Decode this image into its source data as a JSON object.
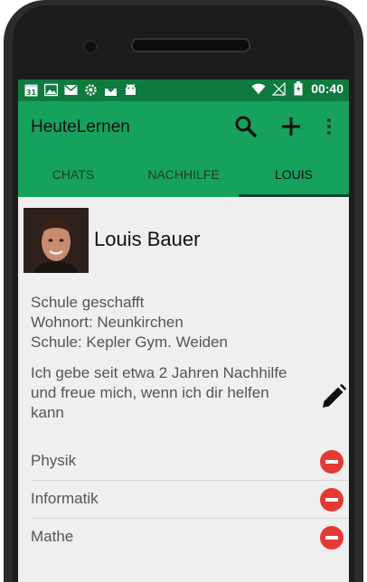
{
  "status_bar": {
    "time": "00:40",
    "calendar_day": "31"
  },
  "app_bar": {
    "title": "HeuteLernen"
  },
  "tabs": [
    {
      "label": "CHATS",
      "active": false
    },
    {
      "label": "NACHHILFE",
      "active": false
    },
    {
      "label": "LOUIS",
      "active": true
    }
  ],
  "profile": {
    "name": "Louis Bauer",
    "info_lines": [
      "Schule geschafft",
      "Wohnort: Neunkirchen",
      "Schule: Kepler Gym. Weiden"
    ],
    "bio_lines": [
      "Ich gebe seit etwa 2 Jahren Nachhilfe",
      "und freue mich, wenn ich dir helfen",
      "kann"
    ]
  },
  "subjects": [
    {
      "label": "Physik"
    },
    {
      "label": "Informatik"
    },
    {
      "label": "Mathe"
    }
  ],
  "colors": {
    "statusbar": "#0f7a3e",
    "appbar": "#16a15c",
    "remove": "#e53935"
  },
  "icons": {
    "search": "search-icon",
    "add": "plus-icon",
    "more": "more-vert-icon",
    "edit": "pencil-icon",
    "remove": "remove-circle-icon"
  }
}
